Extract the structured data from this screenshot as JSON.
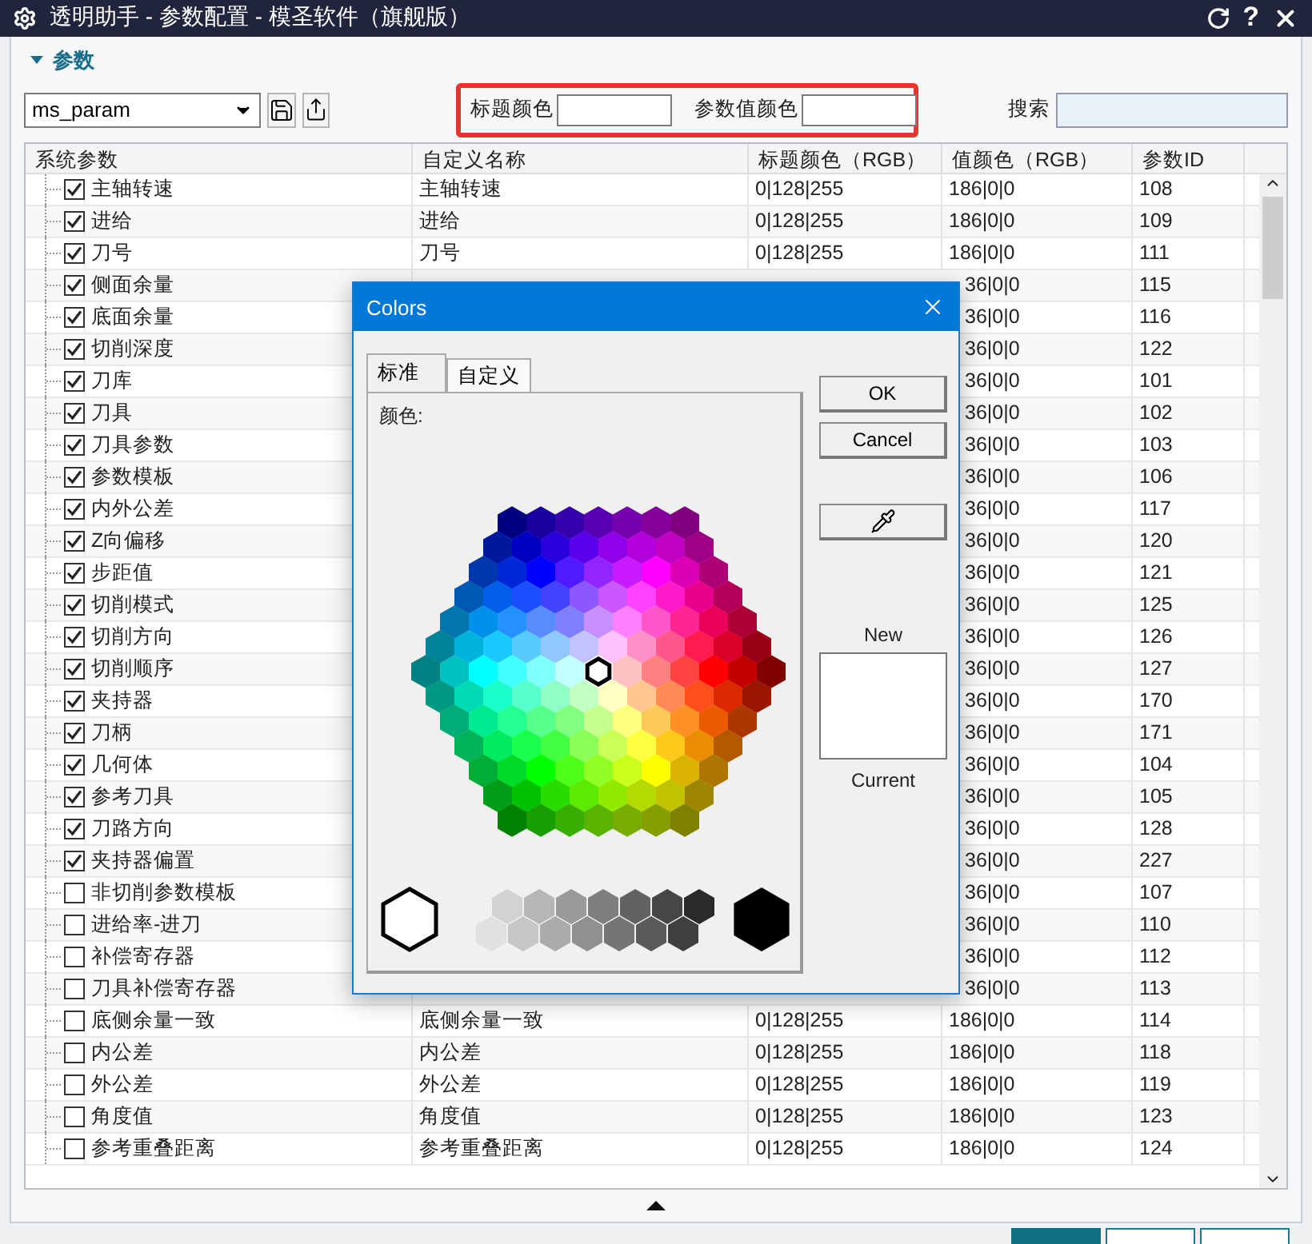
{
  "window": {
    "title": "透明助手 - 参数配置 - 模圣软件（旗舰版）",
    "help": "?"
  },
  "section": {
    "title": "参数",
    "expanded": true
  },
  "toolbar": {
    "template": "ms_param",
    "title_color_label": "标题颜色",
    "value_color_label": "参数值颜色",
    "search_label": "搜索"
  },
  "table": {
    "columns": [
      "系统参数",
      "自定义名称",
      "标题颜色（RGB）",
      "值颜色（RGB）",
      "参数ID"
    ],
    "rows": [
      {
        "name": "主轴转速",
        "checked": true,
        "custom_name": "主轴转速",
        "title_color": "0|128|255",
        "value_color": "186|0|0",
        "id": "108"
      },
      {
        "name": "进给",
        "checked": true,
        "custom_name": "进给",
        "title_color": "0|128|255",
        "value_color": "186|0|0",
        "id": "109"
      },
      {
        "name": "刀号",
        "checked": true,
        "custom_name": "刀号",
        "title_color": "0|128|255",
        "value_color": "186|0|0",
        "id": "111"
      },
      {
        "name": "侧面余量",
        "checked": true,
        "value_color": "36|0|0",
        "id": "115"
      },
      {
        "name": "底面余量",
        "checked": true,
        "value_color": "36|0|0",
        "id": "116"
      },
      {
        "name": "切削深度",
        "checked": true,
        "value_color": "36|0|0",
        "id": "122"
      },
      {
        "name": "刀库",
        "checked": true,
        "value_color": "36|0|0",
        "id": "101"
      },
      {
        "name": "刀具",
        "checked": true,
        "value_color": "36|0|0",
        "id": "102"
      },
      {
        "name": "刀具参数",
        "checked": true,
        "value_color": "36|0|0",
        "id": "103"
      },
      {
        "name": "参数模板",
        "checked": true,
        "value_color": "36|0|0",
        "id": "106"
      },
      {
        "name": "内外公差",
        "checked": true,
        "value_color": "36|0|0",
        "id": "117"
      },
      {
        "name": "Z向偏移",
        "checked": true,
        "value_color": "36|0|0",
        "id": "120"
      },
      {
        "name": "步距值",
        "checked": true,
        "value_color": "36|0|0",
        "id": "121"
      },
      {
        "name": "切削模式",
        "checked": true,
        "value_color": "36|0|0",
        "id": "125"
      },
      {
        "name": "切削方向",
        "checked": true,
        "value_color": "36|0|0",
        "id": "126"
      },
      {
        "name": "切削顺序",
        "checked": true,
        "value_color": "36|0|0",
        "id": "127"
      },
      {
        "name": "夹持器",
        "checked": true,
        "value_color": "36|0|0",
        "id": "170"
      },
      {
        "name": "刀柄",
        "checked": true,
        "value_color": "36|0|0",
        "id": "171"
      },
      {
        "name": "几何体",
        "checked": true,
        "value_color": "36|0|0",
        "id": "104"
      },
      {
        "name": "参考刀具",
        "checked": true,
        "value_color": "36|0|0",
        "id": "105"
      },
      {
        "name": "刀路方向",
        "checked": true,
        "value_color": "36|0|0",
        "id": "128"
      },
      {
        "name": "夹持器偏置",
        "checked": true,
        "value_color": "36|0|0",
        "id": "227"
      },
      {
        "name": "非切削参数模板",
        "checked": false,
        "value_color": "36|0|0",
        "id": "107"
      },
      {
        "name": "进给率-进刀",
        "checked": false,
        "value_color": "36|0|0",
        "id": "110"
      },
      {
        "name": "补偿寄存器",
        "checked": false,
        "value_color": "36|0|0",
        "id": "112"
      },
      {
        "name": "刀具补偿寄存器",
        "checked": false,
        "value_color": "36|0|0",
        "id": "113"
      },
      {
        "name": "底侧余量一致",
        "checked": false,
        "custom_name": "底侧余量一致",
        "title_color": "0|128|255",
        "value_color": "186|0|0",
        "id": "114"
      },
      {
        "name": "内公差",
        "checked": false,
        "custom_name": "内公差",
        "title_color": "0|128|255",
        "value_color": "186|0|0",
        "id": "118"
      },
      {
        "name": "外公差",
        "checked": false,
        "custom_name": "外公差",
        "title_color": "0|128|255",
        "value_color": "186|0|0",
        "id": "119"
      },
      {
        "name": "角度值",
        "checked": false,
        "custom_name": "角度值",
        "title_color": "0|128|255",
        "value_color": "186|0|0",
        "id": "123"
      },
      {
        "name": "参考重叠距离",
        "checked": false,
        "custom_name": "参考重叠距离",
        "title_color": "0|128|255",
        "value_color": "186|0|0",
        "id": "124"
      }
    ]
  },
  "colors_dialog": {
    "title": "Colors",
    "tabs": [
      {
        "label": "标准",
        "selected": true
      },
      {
        "label": "自定义",
        "selected": false
      }
    ],
    "colors_label": "颜色:",
    "buttons": [
      "OK",
      "Cancel"
    ],
    "new_label": "New",
    "current_label": "Current"
  }
}
